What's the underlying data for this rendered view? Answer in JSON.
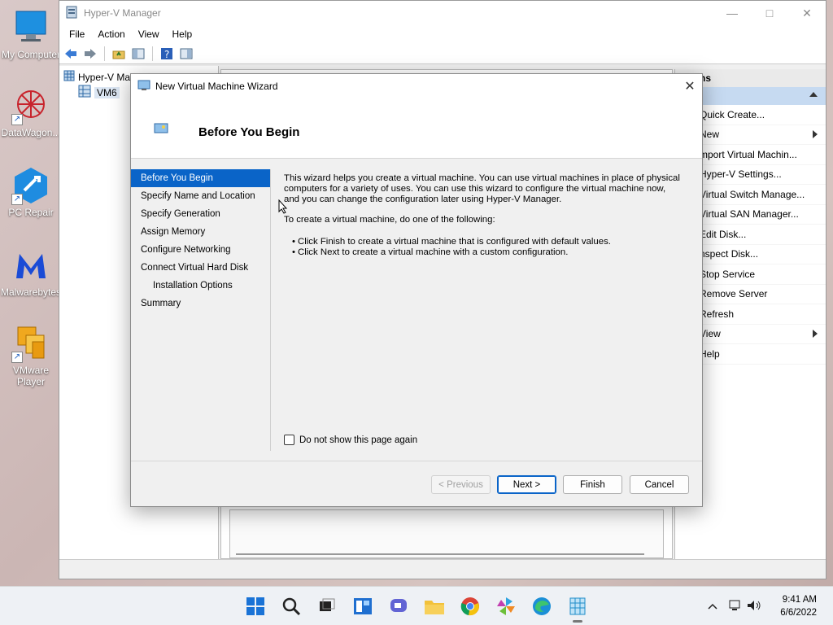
{
  "desktop": {
    "icons": [
      {
        "label": "My Computer",
        "icon": "monitor-icon"
      },
      {
        "label": "DataWagon...",
        "icon": "datawagon-icon"
      },
      {
        "label": "PC Repair",
        "icon": "pc-repair-icon"
      },
      {
        "label": "Malwarebytes",
        "icon": "malwarebytes-icon"
      },
      {
        "label": "VMware Player",
        "icon": "vmware-icon"
      }
    ]
  },
  "mmc": {
    "title": "Hyper-V Manager",
    "menu": [
      "File",
      "Action",
      "View",
      "Help"
    ],
    "tree": {
      "root": "Hyper-V Ma",
      "child": "VM6"
    },
    "actions": {
      "header": "ns",
      "items": [
        "Quick Create...",
        "New",
        "mport Virtual Machin...",
        "Hyper-V Settings...",
        "Virtual Switch Manage...",
        "Virtual SAN Manager...",
        "Edit Disk...",
        "nspect Disk...",
        "Stop Service",
        "Remove Server",
        "Refresh",
        "View",
        "Help"
      ]
    }
  },
  "wizard": {
    "title": "New Virtual Machine Wizard",
    "heading": "Before You Begin",
    "steps": [
      "Before You Begin",
      "Specify Name and Location",
      "Specify Generation",
      "Assign Memory",
      "Configure Networking",
      "Connect Virtual Hard Disk",
      "Installation Options",
      "Summary"
    ],
    "intro": "This wizard helps you create a virtual machine. You can use virtual machines in place of physical computers for a variety of uses. You can use this wizard to configure the virtual machine now, and you can change the configuration later using Hyper-V Manager.",
    "instruction": "To create a virtual machine, do one of the following:",
    "bullets": [
      "Click Finish to create a virtual machine that is configured with default values.",
      "Click Next to create a virtual machine with a custom configuration."
    ],
    "checkbox_label": "Do not show this page again",
    "buttons": {
      "previous": "< Previous",
      "next": "Next >",
      "finish": "Finish",
      "cancel": "Cancel"
    }
  },
  "taskbar": {
    "apps": [
      "start-icon",
      "search-icon",
      "task-view-icon",
      "widgets-icon",
      "chat-icon",
      "file-explorer-icon",
      "chrome-icon",
      "pinwheel-app-icon",
      "edge-icon",
      "hyperv-manager-icon"
    ],
    "clock": {
      "time": "9:41 AM",
      "date": "6/6/2022"
    }
  }
}
